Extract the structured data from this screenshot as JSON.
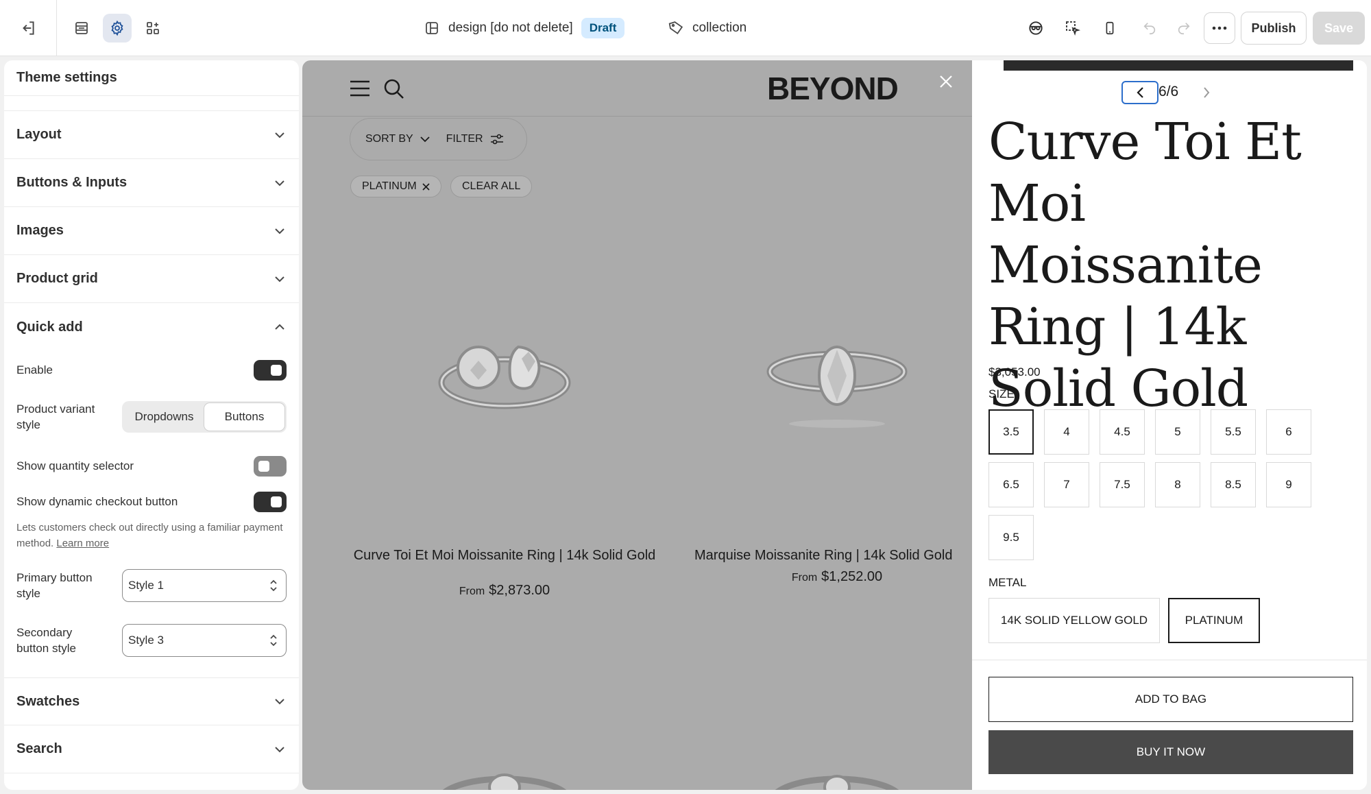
{
  "topbar": {
    "theme_name": "design [do not delete]",
    "status_badge": "Draft",
    "template_name": "collection",
    "publish_label": "Publish",
    "save_label": "Save"
  },
  "sidebar": {
    "title": "Theme settings",
    "sections": {
      "layout": "Layout",
      "buttons_inputs": "Buttons & Inputs",
      "images": "Images",
      "product_grid": "Product grid",
      "quick_add": "Quick add",
      "swatches": "Swatches",
      "search": "Search"
    },
    "quick_add": {
      "enable_label": "Enable",
      "enable_on": true,
      "variant_style_label": "Product variant style",
      "variant_options": [
        "Dropdowns",
        "Buttons"
      ],
      "variant_selected": "Buttons",
      "quantity_label": "Show quantity selector",
      "quantity_on": false,
      "checkout_label": "Show dynamic checkout button",
      "checkout_on": true,
      "checkout_help": "Lets customers check out directly using a familiar payment method.",
      "learn_more": "Learn more",
      "primary_label": "Primary button style",
      "primary_value": "Style 1",
      "secondary_label": "Secondary button style",
      "secondary_value": "Style 3"
    }
  },
  "store": {
    "logo": "BEYOND",
    "sort_by": "SORT BY",
    "filter": "FILTER",
    "active_filter": "PLATINUM",
    "clear_all": "CLEAR ALL",
    "products": [
      {
        "name": "Curve Toi Et Moi Moissanite Ring | 14k Solid Gold",
        "from": "From",
        "price": "$2,873.00"
      },
      {
        "name": "Marquise Moissanite Ring | 14k Solid Gold",
        "from": "From",
        "price": "$1,252.00"
      }
    ]
  },
  "quick_add_panel": {
    "pager": "6/6",
    "title": "Curve Toi Et Moi Moissanite Ring | 14k Solid Gold",
    "price": "$3,053.00",
    "size_label": "SIZE",
    "sizes": [
      "3.5",
      "4",
      "4.5",
      "5",
      "5.5",
      "6",
      "6.5",
      "7",
      "7.5",
      "8",
      "8.5",
      "9",
      "9.5"
    ],
    "selected_size": "3.5",
    "metal_label": "METAL",
    "metals": [
      "14K SOLID YELLOW GOLD",
      "PLATINUM"
    ],
    "selected_metal": "PLATINUM",
    "add_to_bag": "ADD TO BAG",
    "buy_now": "BUY IT NOW"
  }
}
